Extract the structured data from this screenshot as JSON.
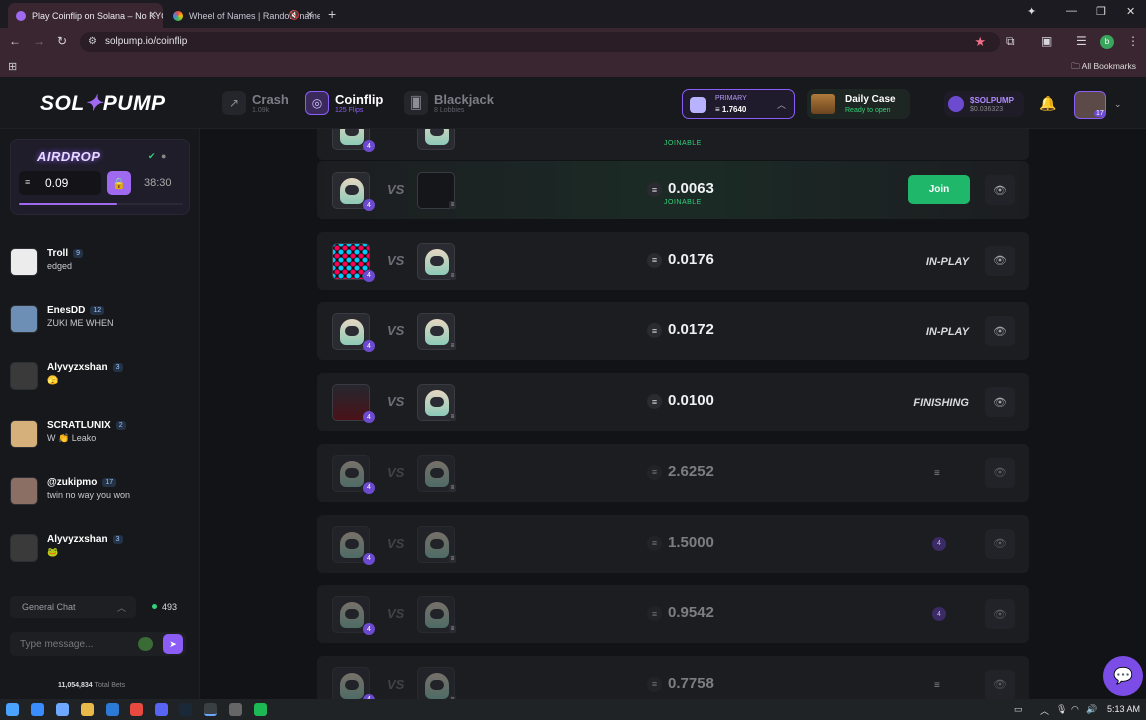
{
  "browser": {
    "tabs": [
      {
        "title": "Play Coinflip on Solana – No KYC",
        "active": true,
        "favicon_color": "#a06af0"
      },
      {
        "title": "Wheel of Names | Random name picker",
        "active": false,
        "favicon_color": "#e94a3f"
      }
    ],
    "url": "solpump.io/coinflip",
    "all_bookmarks": "All Bookmarks",
    "profile_initial": "b"
  },
  "header": {
    "logo_left": "SOL",
    "logo_right": "PUMP",
    "nav": [
      {
        "title": "Crash",
        "sub": "1.09k",
        "icon": "chart-icon",
        "active": false
      },
      {
        "title": "Coinflip",
        "sub": "125 Flips",
        "icon": "coinflip-icon",
        "active": true
      },
      {
        "title": "Blackjack",
        "sub": "8 Lobbies",
        "icon": "cards-icon",
        "active": false
      }
    ],
    "wallet": {
      "label": "PRIMARY",
      "value": "≡ 1.7640"
    },
    "daily_case": {
      "title": "Daily Case",
      "status": "Ready to open"
    },
    "token": {
      "name": "$SOLPUMP",
      "value": "$0.036323"
    },
    "user_level": "17"
  },
  "airdrop": {
    "title": "AIRDROP",
    "amount": "0.09",
    "timer": "38:30",
    "progress": 0.6
  },
  "chat": {
    "messages": [
      {
        "name": "Troll",
        "level": "9",
        "text": "edged",
        "avatar_color": "#ececec"
      },
      {
        "name": "EnesDD",
        "level": "12",
        "text": "ZUKI ME WHEN",
        "avatar_color": "#6d8fb5"
      },
      {
        "name": "Alyvyzxshan",
        "level": "3",
        "text": "🫣",
        "avatar_color": "#3a3a3a"
      },
      {
        "name": "SCRATLUNIX",
        "level": "2",
        "text": "W 👏 Leako",
        "avatar_color": "#d6b07a"
      },
      {
        "name": "@zukipmo",
        "level": "17",
        "text": "twin no way you won",
        "avatar_color": "#8c6f64"
      },
      {
        "name": "Alyvyzxshan",
        "level": "3",
        "text": "🐸",
        "avatar_color": "#3a3a3a"
      }
    ],
    "channel": "General Chat",
    "online": "493",
    "input_placeholder": "Type message...",
    "total_bets_value": "11,054,834",
    "total_bets_label": "Total Bets"
  },
  "games": {
    "join_label": "Join",
    "joinable_label": "JOINABLE",
    "rows": [
      {
        "amount": "0.0063",
        "status": "",
        "joinable": true,
        "left": "astro",
        "right": "empty"
      },
      {
        "amount": "0.0176",
        "status": "IN-PLAY",
        "joinable": false,
        "left": "dots",
        "right": "astro"
      },
      {
        "amount": "0.0172",
        "status": "IN-PLAY",
        "joinable": false,
        "left": "astro",
        "right": "astro"
      },
      {
        "amount": "0.0100",
        "status": "FINISHING",
        "joinable": false,
        "left": "poster",
        "right": "astro"
      },
      {
        "amount": "2.6252",
        "status": "",
        "joinable": false,
        "left": "astro",
        "right": "astro"
      },
      {
        "amount": "1.5000",
        "status": "",
        "joinable": false,
        "left": "astro",
        "right": "astro"
      },
      {
        "amount": "0.9542",
        "status": "",
        "joinable": false,
        "left": "astro",
        "right": "astro"
      },
      {
        "amount": "0.7758",
        "status": "",
        "joinable": false,
        "left": "astro",
        "right": "astro"
      }
    ],
    "top_partial_label": "JOINABLE"
  },
  "taskbar": {
    "time": "5:13 AM"
  }
}
